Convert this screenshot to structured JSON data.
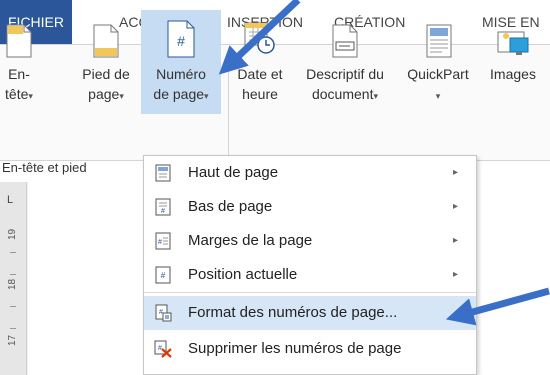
{
  "tabs": [
    "FICHIER",
    "ACCUEIL",
    "INSERTION",
    "CRÉATION",
    "MISE EN"
  ],
  "ribbon": {
    "buttons": [
      {
        "line1": "En-",
        "line2": "tête",
        "caret": true
      },
      {
        "line1": "Pied de",
        "line2": "page",
        "caret": true
      },
      {
        "line1": "Numéro",
        "line2": "de page",
        "caret": true
      },
      {
        "line1": "Date et",
        "line2": "heure",
        "caret": false
      },
      {
        "line1": "Descriptif du",
        "line2": "document",
        "caret": true
      },
      {
        "line1": "QuickPart",
        "line2": "",
        "caret": true
      },
      {
        "line1": "Images",
        "line2": "",
        "caret": false
      }
    ],
    "group_label": "En-tête et pied",
    "caret_glyph": "▾"
  },
  "ruler": {
    "numbers": [
      "19",
      "18",
      "17"
    ],
    "marker": "L"
  },
  "menu": {
    "items": [
      {
        "label": "Haut de page",
        "submenu": true,
        "icon": "page-top-icon"
      },
      {
        "label": "Bas de page",
        "submenu": true,
        "icon": "page-bottom-icon"
      },
      {
        "label": "Marges de la page",
        "submenu": true,
        "icon": "page-margins-icon"
      },
      {
        "label": "Position actuelle",
        "submenu": true,
        "icon": "current-position-icon"
      },
      {
        "label": "Format des numéros de page...",
        "submenu": false,
        "icon": "format-numbers-icon"
      },
      {
        "label": "Supprimer les numéros de page",
        "submenu": false,
        "icon": "delete-numbers-icon"
      }
    ],
    "arrow_glyph": "▸"
  },
  "colors": {
    "accent": "#2b579a",
    "highlight": "#c6dcf3",
    "menu_highlight": "#d7e6f7",
    "annotation_arrow": "#3a6fc7",
    "delete_red": "#d83b01"
  }
}
